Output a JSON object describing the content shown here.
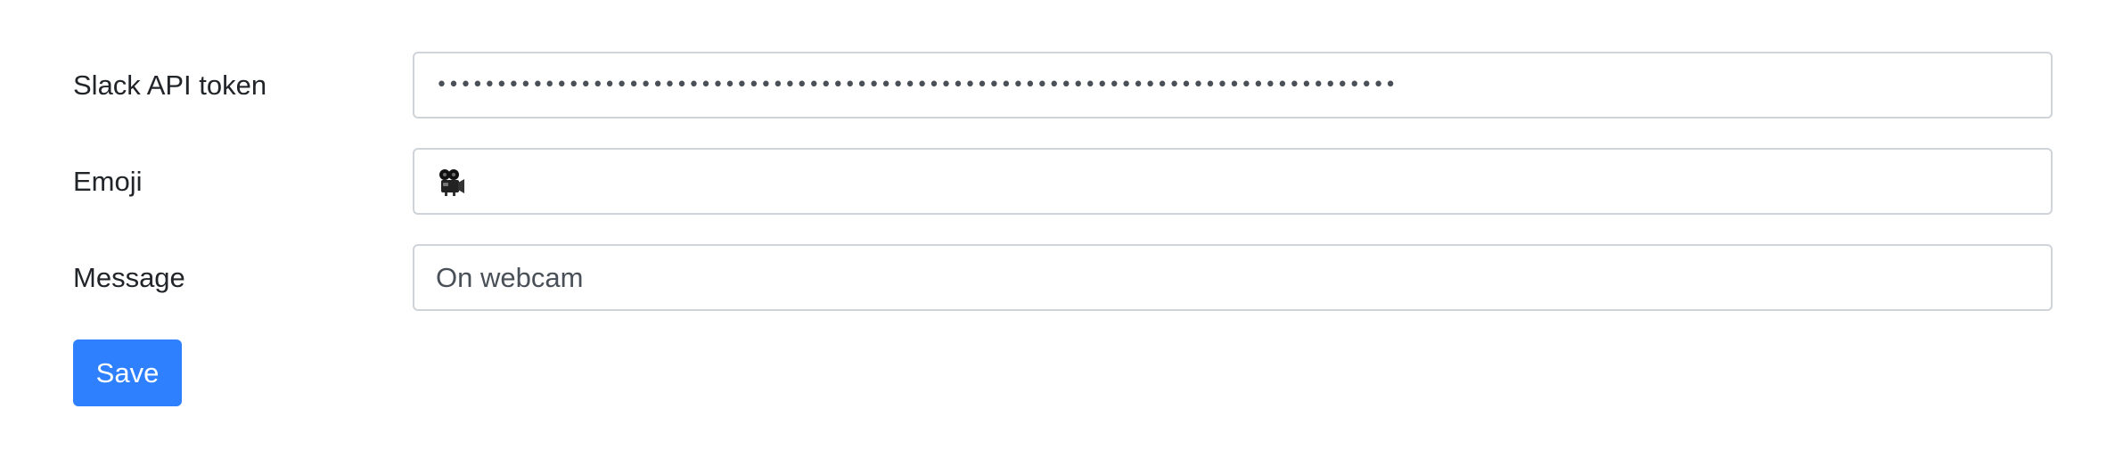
{
  "form": {
    "fields": [
      {
        "label": "Slack API token",
        "value": "••••••••••••••••••••••••••••••••••••••••••••••••••••••••••••••••••••••••••••••••"
      },
      {
        "label": "Emoji",
        "value": "🎥",
        "icon": "movie-camera-icon"
      },
      {
        "label": "Message",
        "value": "On webcam"
      }
    ],
    "save_label": "Save"
  },
  "colors": {
    "primary": "#2f80ff",
    "input_border": "#ced4da",
    "text": "#212529",
    "input_text": "#495057"
  }
}
